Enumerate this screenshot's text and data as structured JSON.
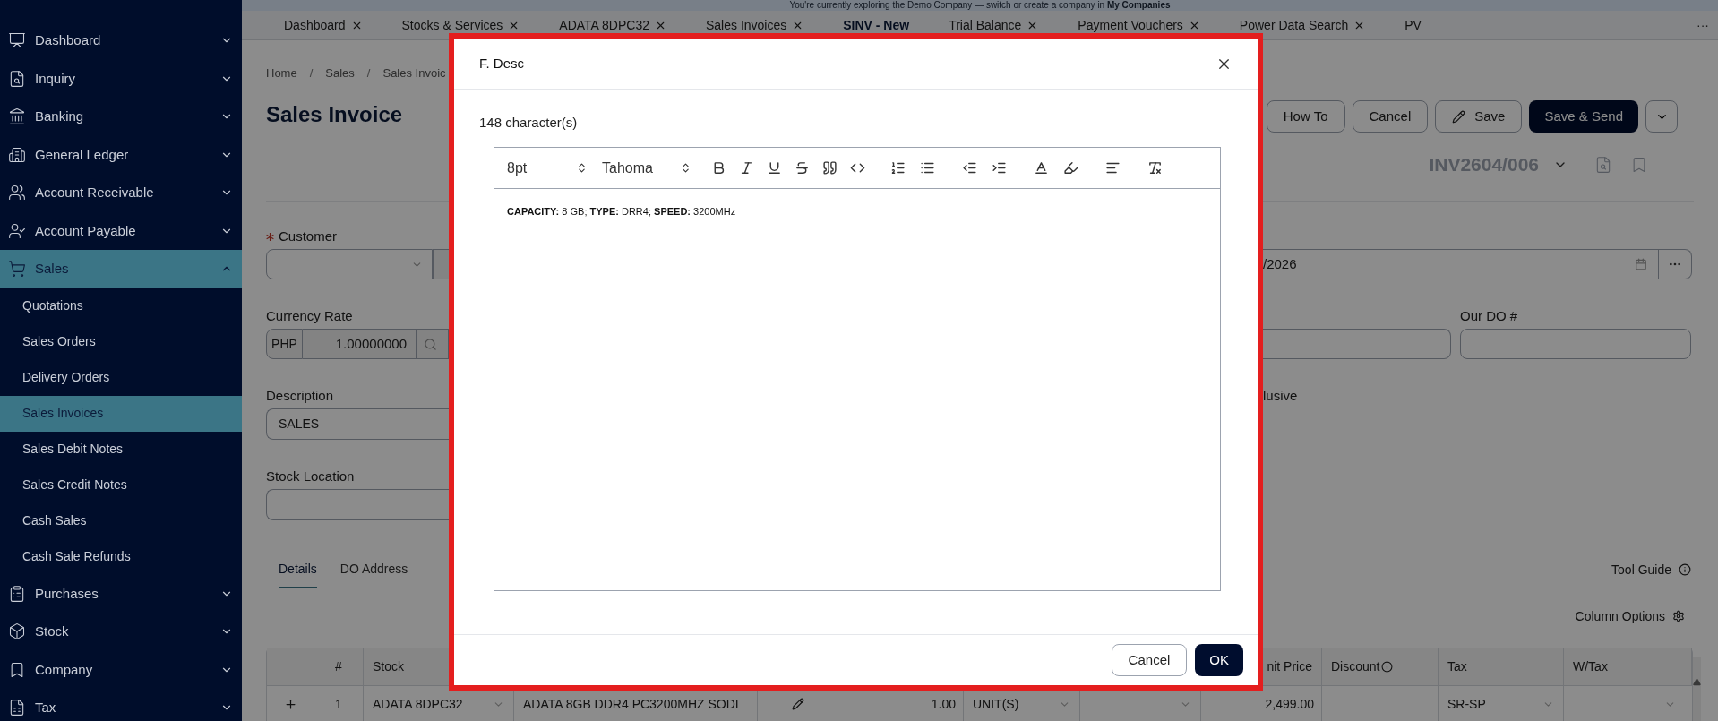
{
  "banner": {
    "text": "You're currently exploring the Demo Company — switch or create a company in **My Companies**"
  },
  "sidebar": {
    "items": [
      {
        "label": "Dashboard",
        "expanded": false,
        "selected": false
      },
      {
        "label": "Inquiry",
        "expanded": false,
        "selected": false
      },
      {
        "label": "Banking",
        "expanded": false,
        "selected": false
      },
      {
        "label": "General Ledger",
        "expanded": false,
        "selected": false
      },
      {
        "label": "Account Receivable",
        "expanded": false,
        "selected": false
      },
      {
        "label": "Account Payable",
        "expanded": false,
        "selected": false
      },
      {
        "label": "Sales",
        "expanded": true,
        "selected": true,
        "children": [
          {
            "label": "Quotations",
            "selected": false
          },
          {
            "label": "Sales Orders",
            "selected": false
          },
          {
            "label": "Delivery Orders",
            "selected": false
          },
          {
            "label": "Sales Invoices",
            "selected": true
          },
          {
            "label": "Sales Debit Notes",
            "selected": false
          },
          {
            "label": "Sales Credit Notes",
            "selected": false
          },
          {
            "label": "Cash Sales",
            "selected": false
          },
          {
            "label": "Cash Sale Refunds",
            "selected": false
          }
        ]
      },
      {
        "label": "Purchases",
        "expanded": false,
        "selected": false
      },
      {
        "label": "Stock",
        "expanded": false,
        "selected": false
      },
      {
        "label": "Company",
        "expanded": false,
        "selected": false
      },
      {
        "label": "Tax",
        "expanded": false,
        "selected": false
      }
    ]
  },
  "tabs": [
    {
      "label": "Dashboard",
      "selected": false,
      "closable": true
    },
    {
      "label": "Stocks & Services",
      "selected": false,
      "closable": true
    },
    {
      "label": "ADATA 8DPC32",
      "selected": false,
      "closable": true
    },
    {
      "label": "Sales Invoices",
      "selected": false,
      "closable": true
    },
    {
      "label": "SINV - New",
      "selected": true,
      "closable": false
    },
    {
      "label": "Trial Balance",
      "selected": false,
      "closable": true
    },
    {
      "label": "Payment Vouchers",
      "selected": false,
      "closable": true
    },
    {
      "label": "Power Data Search",
      "selected": false,
      "closable": true
    },
    {
      "label": "PV",
      "selected": false,
      "closable": false
    }
  ],
  "tabs_more": "···",
  "breadcrumb": [
    {
      "label": "Home"
    },
    {
      "separator": "/",
      "label": "Sales"
    },
    {
      "separator": "/",
      "label": "Sales Invoic"
    }
  ],
  "title": "Sales Invoice",
  "actions": [
    {
      "label": "How To",
      "kind": "plain"
    },
    {
      "label": "Cancel",
      "kind": "plain"
    },
    {
      "label": "Save",
      "kind": "edit"
    },
    {
      "label": "Save & Send",
      "kind": "primary"
    },
    {
      "kind": "caret"
    }
  ],
  "doc_number": "INV2604/006",
  "form": {
    "customer": {
      "label": "Customer",
      "required": true
    },
    "date": {
      "value": "/2026"
    },
    "currency": {
      "label": "Currency Rate",
      "code": "PHP",
      "rate": "1.00000000"
    },
    "our_do": {
      "label": "Our DO #"
    },
    "description": {
      "label": "Description",
      "value": "SALES"
    },
    "tax_label": "lusive",
    "stock_location": {
      "label": "Stock Location"
    }
  },
  "detail_tabs": [
    {
      "label": "Details",
      "selected": true
    },
    {
      "label": "DO Address",
      "selected": false
    }
  ],
  "tool_guide": "Tool Guide",
  "column_options": "Column Options",
  "table": {
    "columns": [
      "#",
      "Stock",
      "nit Price",
      "Discount",
      "Tax",
      "W/Tax"
    ],
    "rows": [
      {
        "no": "1",
        "stock": "ADATA 8DPC32",
        "description": "ADATA 8GB DDR4 PC3200MHZ SODI",
        "qty": "1.00",
        "uom": "UNIT(S)",
        "unit_price": "2,499.00",
        "tax": "SR-SP"
      }
    ]
  },
  "dialog": {
    "title": "F. Desc",
    "count": "148 character(s)",
    "font_size": "8pt",
    "font": "Tahoma",
    "content": "**CAPACITY:** 8 GB; **TYPE:** DRR4; **SPEED:** 3200MHz",
    "buttons": [
      {
        "label": "Cancel",
        "kind": "secondary"
      },
      {
        "label": "OK",
        "kind": "primary"
      }
    ]
  }
}
